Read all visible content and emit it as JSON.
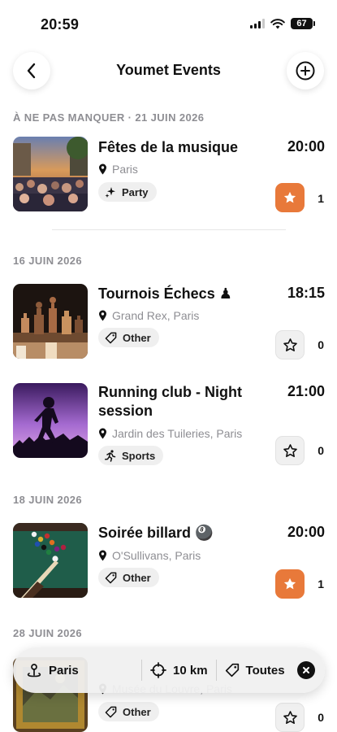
{
  "status_bar": {
    "time": "20:59",
    "battery": "67"
  },
  "header": {
    "title": "Youmet Events"
  },
  "sections": [
    {
      "header": "À NE PAS MANQUER · 21 JUIN 2026",
      "events": [
        {
          "title": "Fêtes de la musique",
          "time": "20:00",
          "location": "Paris",
          "category": "Party",
          "starred": true,
          "star_count": "1",
          "thumbnail": "street-crowd-photo"
        }
      ]
    },
    {
      "header": "16 JUIN 2026",
      "events": [
        {
          "title": "Tournois Échecs ♟",
          "time": "18:15",
          "location": "Grand Rex, Paris",
          "category": "Other",
          "starred": false,
          "star_count": "0",
          "thumbnail": "chess-pieces-photo"
        },
        {
          "title": "Running club - Night session",
          "time": "21:00",
          "location": "Jardin des Tuileries, Paris",
          "category": "Sports",
          "starred": false,
          "star_count": "0",
          "thumbnail": "runner-silhouette-photo"
        }
      ]
    },
    {
      "header": "18 JUIN 2026",
      "events": [
        {
          "title": "Soirée billard 🎱",
          "time": "20:00",
          "location": "O'Sullivans, Paris",
          "category": "Other",
          "starred": true,
          "star_count": "1",
          "thumbnail": "billiard-table-photo"
        }
      ]
    },
    {
      "header": "28 JUIN 2026",
      "events": [
        {
          "title": "",
          "time": "",
          "location": "Musée du Louvre, Paris",
          "category": "Other",
          "starred": false,
          "star_count": "0",
          "thumbnail": "painting-photo"
        }
      ]
    }
  ],
  "filter_bar": {
    "city": "Paris",
    "radius": "10 km",
    "category": "Toutes"
  },
  "colors": {
    "accent": "#e8793a",
    "muted_text": "#8e8e93",
    "chip_bg": "#efefef"
  },
  "icons": [
    "chevron-left-icon",
    "plus-circle-icon",
    "location-pin-icon",
    "sparkles-icon",
    "tag-icon",
    "running-icon",
    "star-icon",
    "crosshair-icon",
    "close-circle-icon"
  ]
}
